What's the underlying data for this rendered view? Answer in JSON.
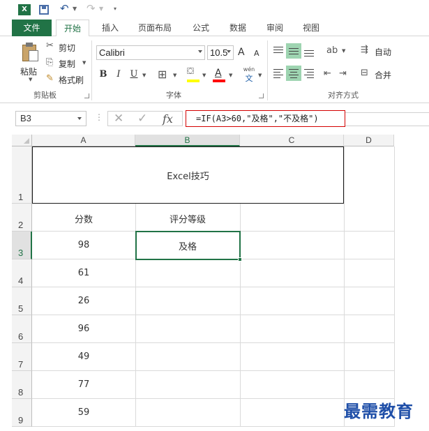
{
  "qat": {
    "app_icon_text": "X",
    "undo_icon": "undo-icon",
    "redo_icon": "redo-icon"
  },
  "ribbon_tabs": [
    "文件",
    "开始",
    "插入",
    "页面布局",
    "公式",
    "数据",
    "审阅",
    "视图"
  ],
  "clipboard": {
    "paste_label": "粘贴",
    "cut_label": "剪切",
    "copy_label": "复制",
    "format_painter_label": "格式刷",
    "group_label": "剪贴板"
  },
  "font_group": {
    "font_name": "Calibri",
    "font_size": "10.5",
    "grow_label": "A",
    "shrink_label": "A",
    "bold_label": "B",
    "italic_label": "I",
    "underline_label": "U",
    "phonetic_label": "wén",
    "phonetic_char": "文",
    "group_label": "字体",
    "highlight_color": "#ffff00",
    "font_color": "#ff0000"
  },
  "alignment_group": {
    "wrap_label": "自动",
    "merge_label": "合并",
    "group_label": "对齐方式"
  },
  "formula_bar": {
    "name_box": "B3",
    "fx_label": "fx",
    "formula": "=IF(A3>60,\"及格\",\"不及格\")"
  },
  "grid": {
    "columns": [
      "A",
      "B",
      "C",
      "D"
    ],
    "selected_column": "B",
    "rows": [
      "1",
      "2",
      "3",
      "4",
      "5",
      "6",
      "7",
      "8",
      "9"
    ],
    "selected_row": "3",
    "title": "Excel技巧",
    "header_a": "分数",
    "header_b": "评分等级",
    "scores": [
      "98",
      "61",
      "26",
      "96",
      "49",
      "77",
      "59"
    ],
    "grades": [
      "及格",
      "",
      "",
      "",
      "",
      "",
      ""
    ],
    "accent_color": "#217346"
  },
  "watermark": "最需教育"
}
